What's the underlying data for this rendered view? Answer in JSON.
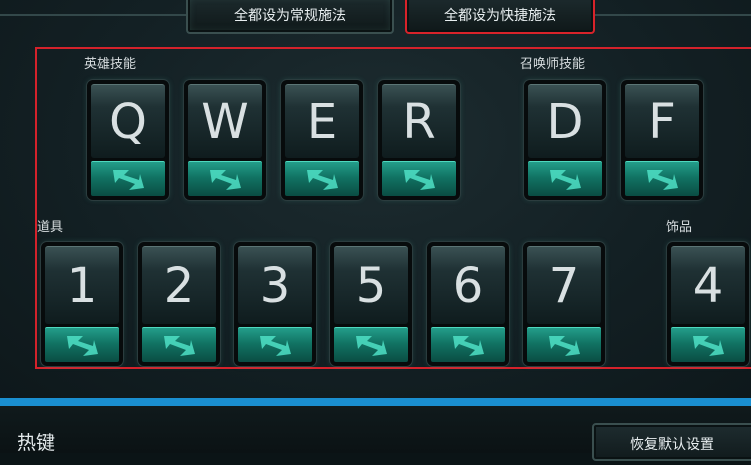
{
  "top_buttons": {
    "normal_cast": "全都设为常规施法",
    "quick_cast": "全都设为快捷施法"
  },
  "groups": {
    "hero_skills": "英雄技能",
    "summoner_skills": "召唤师技能",
    "items": "道具",
    "trinket": "饰品"
  },
  "hero_keys": [
    "Q",
    "W",
    "E",
    "R"
  ],
  "summoner_keys": [
    "D",
    "F"
  ],
  "item_keys": [
    "1",
    "2",
    "3",
    "5",
    "6",
    "7"
  ],
  "trinket_key": "4",
  "bottom": {
    "title": "热键",
    "reset": "恢复默认设置"
  },
  "colors": {
    "selection_border": "#d4222b",
    "divider": "#1a8fd0",
    "quick_cast_teal": "#1a8a78"
  },
  "icons": {
    "quick_cast_arrow": "quick-cast-arrow-icon"
  }
}
